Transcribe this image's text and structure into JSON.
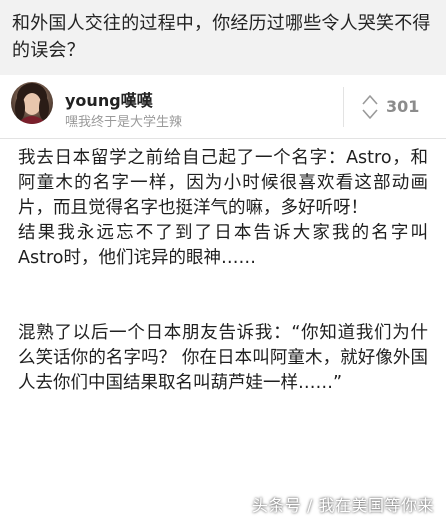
{
  "question": {
    "title": "和外国人交往的过程中，你经历过哪些令人哭笑不得的误会？"
  },
  "author": {
    "name": "young嘆嘆",
    "bio": "嘿我终于是大学生辣"
  },
  "vote": {
    "count": "301",
    "icon": "upvote-arrows-icon"
  },
  "answer": {
    "paragraphs": [
      "我去日本留学之前给自己起了一个名字：Astro，和阿童木的名字一样，因为小时候很喜欢看这部动画片，而且觉得名字也挺洋气的嘛，多好听呀！",
      "结果我永远忘不了到了日本告诉大家我的名字叫Astro时，他们诧异的眼神……",
      "混熟了以后一个日本朋友告诉我：“你知道我们为什么笑话你的名字吗？ 你在日本叫阿童木，就好像外国人去你们中国结果取名叫葫芦娃一样……”"
    ]
  },
  "watermark": {
    "text": "头条号 / 我在美国等你来"
  },
  "colors": {
    "question_bg": "#f2f2f2",
    "text_primary": "#1f1f1f",
    "text_secondary": "#9a9a9a",
    "vote_gray": "#8c8c8c"
  }
}
